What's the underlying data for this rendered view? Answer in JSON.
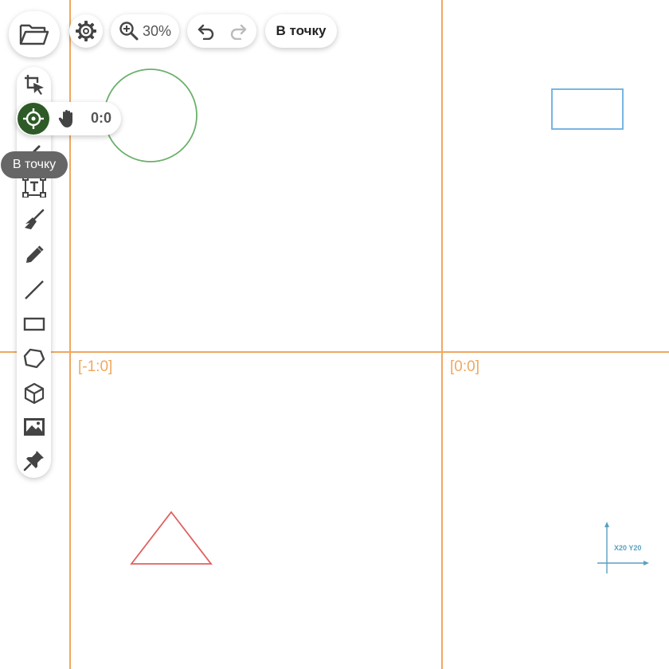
{
  "canvas": {
    "grid_color": "#f0a860",
    "cell_labels": [
      "[-1:0]",
      "[0:0]"
    ],
    "axis_marker_label": "X20 Y20"
  },
  "toolbar_top": {
    "zoom_level": "30%",
    "goto_point_label": "В точку"
  },
  "toolbar_left": {
    "tools": [
      "crop-select-icon",
      "target-icon",
      "pen-icon",
      "text-box-icon",
      "broom-icon",
      "pencil-icon",
      "line-icon",
      "rectangle-icon",
      "polygon-icon",
      "cube-icon",
      "image-icon",
      "pin-icon"
    ]
  },
  "navigation_panel": {
    "coordinates": "0:0",
    "active_color": "#2d5a27"
  },
  "tooltip": {
    "text": "В точку"
  },
  "shapes": {
    "circle_color": "#6bb06b",
    "rectangle_color": "#6aaee0",
    "triangle_color": "#e06060",
    "axis_color": "#5aa0c0"
  }
}
